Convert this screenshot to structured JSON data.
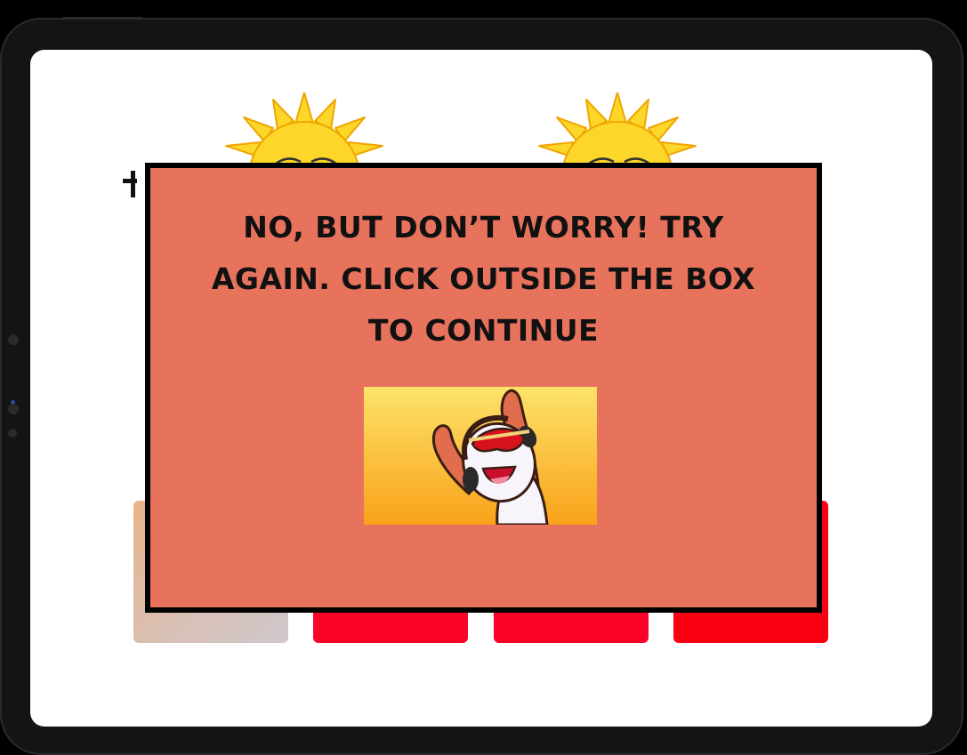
{
  "feedback": {
    "message": "NO, BUT DON’T WORRY! TRY AGAIN. CLICK OUTSIDE THE BOX TO CONTINUE"
  },
  "colors": {
    "modal_background": "#e8735d",
    "modal_border": "#000000",
    "tile_red": "#fb0229",
    "sun_yellow": "#fcd72a"
  },
  "icons": {
    "sun_left": "sun-icon",
    "sun_right": "sun-icon",
    "cartoon": "cheering-character-illustration"
  }
}
